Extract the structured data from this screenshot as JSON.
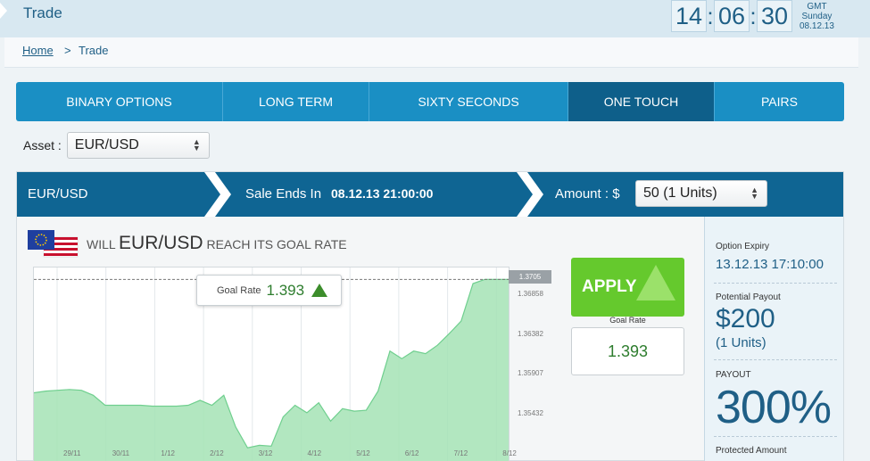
{
  "header": {
    "title": "Trade"
  },
  "clock": {
    "hours": "14",
    "minutes": "06",
    "seconds": "30",
    "zone": "GMT",
    "day": "Sunday",
    "date": "08.12.13"
  },
  "breadcrumb": {
    "home": "Home",
    "separator": ">",
    "current": "Trade"
  },
  "tabs": [
    {
      "label": "BINARY OPTIONS"
    },
    {
      "label": "LONG TERM"
    },
    {
      "label": "SIXTY SECONDS"
    },
    {
      "label": "ONE TOUCH"
    },
    {
      "label": "PAIRS"
    }
  ],
  "active_tab": "ONE TOUCH",
  "asset": {
    "label": "Asset :",
    "selected": "EUR/USD"
  },
  "trade_bar": {
    "pair": "EUR/USD",
    "sale_label": "Sale Ends In",
    "sale_date": "08.12.13 21:00:00",
    "amount_label": "Amount : $",
    "amount_selected": "50 (1 Units)"
  },
  "question": {
    "prefix": "WILL",
    "pair": "EUR/USD",
    "suffix": "REACH ITS GOAL RATE"
  },
  "goal_tooltip": {
    "label": "Goal Rate",
    "value": "1.393"
  },
  "apply": {
    "label": "APPLY",
    "goal_rate_label": "Goal Rate",
    "goal_rate_value": "1.393"
  },
  "option_info": {
    "expiry_label": "Option Expiry",
    "expiry_value": "13.12.13 17:10:00",
    "payout_label": "Potential Payout",
    "payout_value": "$200",
    "payout_units": "(1 Units)",
    "payout_pct_label": "PAYOUT",
    "payout_pct": "300%",
    "protected_label": "Protected Amount"
  },
  "colors": {
    "accent": "#0f6593",
    "tab_blue": "#1a8fc4",
    "apply_green": "#65c92d",
    "chart_fill": "#9fe0b2"
  },
  "chart_data": {
    "type": "area",
    "x_ticks": [
      "29/11",
      "30/11",
      "1/12",
      "2/12",
      "3/12",
      "4/12",
      "5/12",
      "6/12",
      "7/12",
      "8/12"
    ],
    "y_ticks": [
      "1.36858",
      "1.36382",
      "1.35907",
      "1.35432"
    ],
    "current_price": "1.3705",
    "goal_line": 1.3705,
    "ylim": [
      1.35,
      1.3715
    ],
    "values": [
      1.3569,
      1.3571,
      1.3572,
      1.3573,
      1.3572,
      1.3566,
      1.3554,
      1.3554,
      1.3554,
      1.3554,
      1.3553,
      1.3553,
      1.3553,
      1.3554,
      1.356,
      1.3554,
      1.3566,
      1.3528,
      1.3503,
      1.3506,
      1.3505,
      1.354,
      1.3554,
      1.3545,
      1.3557,
      1.3535,
      1.355,
      1.3547,
      1.3548,
      1.3571,
      1.3619,
      1.361,
      1.3619,
      1.3616,
      1.3626,
      1.364,
      1.3655,
      1.37,
      1.3705,
      1.3705,
      1.3705
    ]
  }
}
